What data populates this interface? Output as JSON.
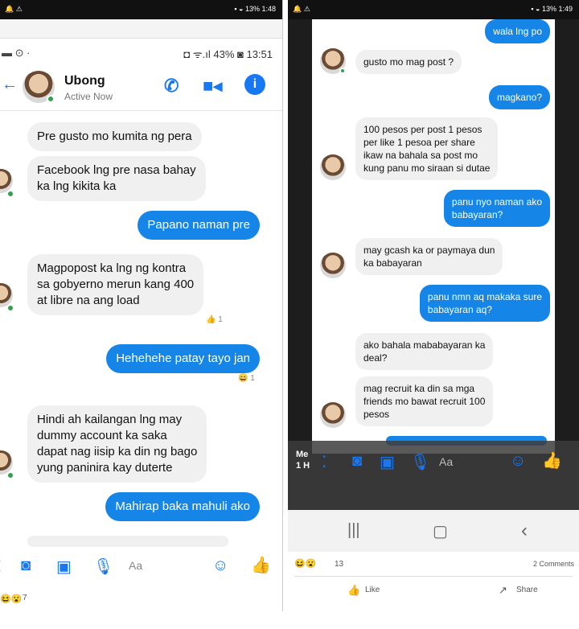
{
  "left": {
    "top_status": {
      "left": "🔔 ⚠",
      "right": "▪ ◒ 13% 1:48"
    },
    "phone_status": {
      "right": "◘ ᯤ.ıl 43% ◙ 13:51",
      "left": "▬ ⊙ ·"
    },
    "header": {
      "name": "Ubong",
      "status": "Active Now"
    },
    "messages": [
      {
        "dir": "in",
        "text": "Pre gusto mo kumita ng pera"
      },
      {
        "dir": "in",
        "text": "Facebook lng pre nasa bahay\nka lng kikita ka"
      },
      {
        "dir": "out",
        "text": "Papano naman pre"
      },
      {
        "dir": "in",
        "text": "Magpopost ka lng ng kontra\nsa gobyerno merun kang 400\nat libre na ang load"
      },
      {
        "dir": "out",
        "text": "Hehehehe patay tayo jan"
      },
      {
        "dir": "in",
        "text": "Hindi ah kailangan lng may\ndummy account ka saka\ndapat nag iisip ka din ng bago\nyung paninira kay duterte"
      },
      {
        "dir": "out",
        "text": "Mahirap baka mahuli ako"
      }
    ],
    "reactions": [
      "👍 1",
      "😄 1"
    ],
    "composer_placeholder": "Aa",
    "footer_count": "7"
  },
  "right": {
    "top_status": {
      "left": "🔔 ⚠",
      "right": "▪ ◒ 13% 1:49"
    },
    "messages": [
      {
        "dir": "out",
        "text": "wala lng po"
      },
      {
        "dir": "in",
        "text": "gusto mo mag post ?"
      },
      {
        "dir": "out",
        "text": "magkano?"
      },
      {
        "dir": "in",
        "text": "100 pesos per post 1 pesos\nper like 1 pesoa per share\nikaw na bahala sa post mo\nkung panu mo siraan si dutae"
      },
      {
        "dir": "out",
        "text": "panu nyo naman ako\nbabayaran?"
      },
      {
        "dir": "in",
        "text": "may gcash ka or paymaya dun\nka babayaran"
      },
      {
        "dir": "out",
        "text": "panu nmn aq makaka sure\nbabayaran aq?"
      },
      {
        "dir": "in",
        "text": "ako bahala mababayaran ka\ndeal?"
      },
      {
        "dir": "in",
        "text": "mag recruit ka din sa mga\nfriends mo bawat recruit 100\npesos"
      }
    ],
    "composer_placeholder": "Aa",
    "overlay_label": "Me\n1 H",
    "reaction_count": "13",
    "comments": "2 Comments",
    "like_label": "Like",
    "share_label": "Share",
    "nav": [
      "|||",
      "▢",
      "‹"
    ]
  },
  "colors": {
    "accent": "#1877f2",
    "bubble_out": "#1585e8",
    "bubble_in": "#f0f0f0"
  }
}
